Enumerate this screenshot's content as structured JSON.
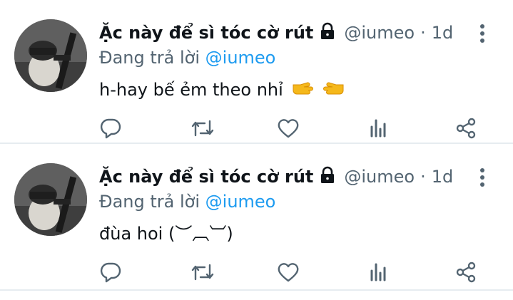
{
  "tweets": [
    {
      "display_name": "Ặc này để sì tóc cờ rút",
      "handle": "@iumeo",
      "separator": "·",
      "time": "1d",
      "reply_prefix": "Đang trả lời",
      "reply_to": "@iumeo",
      "text": "h-hay bế ẻm theo nhỉ",
      "emojis": [
        "pointing-right-hand-icon",
        "pointing-left-hand-icon"
      ]
    },
    {
      "display_name": "Ặc này để sì tóc cờ rút",
      "handle": "@iumeo",
      "separator": "·",
      "time": "1d",
      "reply_prefix": "Đang trả lời",
      "reply_to": "@iumeo",
      "text": "đùa hoi (︶︹︺)",
      "emojis": []
    }
  ],
  "colors": {
    "text_primary": "#0f1419",
    "text_secondary": "#536471",
    "mention": "#1d9bf0",
    "divider": "#e6ecf0",
    "icon": "#536471"
  },
  "action_icons": [
    "reply-icon",
    "retweet-icon",
    "like-icon",
    "analytics-icon",
    "share-icon"
  ]
}
